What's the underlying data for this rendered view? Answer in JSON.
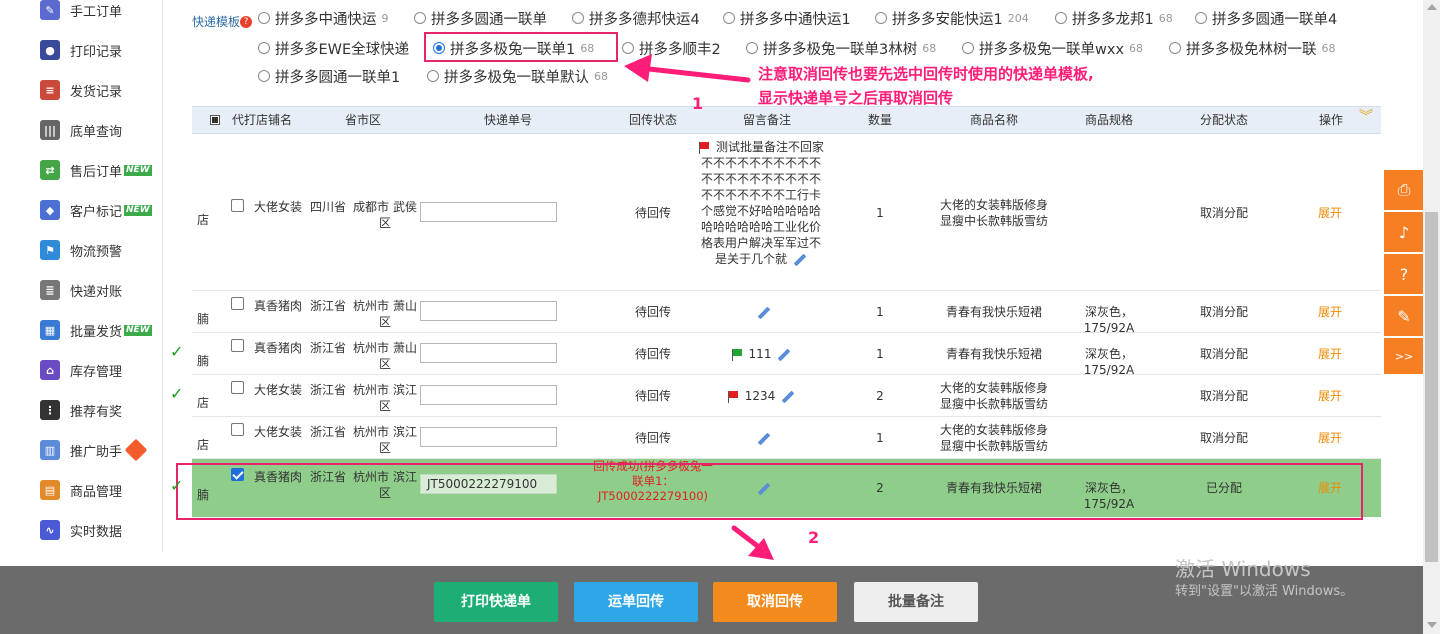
{
  "sidebar": {
    "items": [
      {
        "label": "手工订单",
        "icon": "manual-order-icon",
        "color": "#5a6acf",
        "glyph": "✎"
      },
      {
        "label": "打印记录",
        "icon": "print-record-icon",
        "color": "#3a4a9b",
        "glyph": "●"
      },
      {
        "label": "发货记录",
        "icon": "shipping-record-icon",
        "color": "#c94a3a",
        "glyph": "≡"
      },
      {
        "label": "底单查询",
        "icon": "receipt-query-icon",
        "color": "#666666",
        "glyph": "|||"
      },
      {
        "label": "售后订单",
        "icon": "after-sale-icon",
        "color": "#45a546",
        "glyph": "⇄",
        "badge": "NEW"
      },
      {
        "label": "客户标记",
        "icon": "customer-tag-icon",
        "color": "#4c6fd4",
        "glyph": "◆",
        "badge": "NEW"
      },
      {
        "label": "物流预警",
        "icon": "logistics-alert-icon",
        "color": "#2f8ad8",
        "glyph": "⚑"
      },
      {
        "label": "快递对账",
        "icon": "express-reconcile-icon",
        "color": "#777777",
        "glyph": "≣"
      },
      {
        "label": "批量发货",
        "icon": "batch-ship-icon",
        "color": "#3a79d4",
        "glyph": "▦",
        "badge": "NEW"
      },
      {
        "label": "库存管理",
        "icon": "inventory-icon",
        "color": "#6a4bc4",
        "glyph": "⌂"
      },
      {
        "label": "推荐有奖",
        "icon": "referral-icon",
        "color": "#333333",
        "glyph": "⋮"
      },
      {
        "label": "推广助手",
        "icon": "promotion-icon",
        "color": "#5a8ad8",
        "glyph": "▥",
        "gift": true
      },
      {
        "label": "商品管理",
        "icon": "product-manage-icon",
        "color": "#e28a2a",
        "glyph": "▤"
      },
      {
        "label": "实时数据",
        "icon": "realtime-data-icon",
        "color": "#4a5ad4",
        "glyph": "∿"
      }
    ]
  },
  "templates": {
    "label": "快递模板",
    "options": [
      {
        "label": "拼多多中通快运",
        "count": "9",
        "selected": false
      },
      {
        "label": "拼多多圆通一联单",
        "count": "",
        "selected": false
      },
      {
        "label": "拼多多德邦快运4",
        "count": "",
        "selected": false
      },
      {
        "label": "拼多多中通快运1",
        "count": "",
        "selected": false
      },
      {
        "label": "拼多多安能快运1",
        "count": "204",
        "selected": false
      },
      {
        "label": "拼多多龙邦1",
        "count": "68",
        "selected": false
      },
      {
        "label": "拼多多圆通一联单4",
        "count": "",
        "selected": false
      },
      {
        "label": "拼多多EWE全球快递",
        "count": "",
        "selected": false
      },
      {
        "label": "拼多多极兔一联单1",
        "count": "68",
        "selected": true
      },
      {
        "label": "拼多多顺丰2",
        "count": "",
        "selected": false
      },
      {
        "label": "拼多多极兔一联单3林树",
        "count": "68",
        "selected": false
      },
      {
        "label": "拼多多极兔一联单wxx",
        "count": "68",
        "selected": false
      },
      {
        "label": "拼多多极免林树一联",
        "count": "68",
        "selected": false
      },
      {
        "label": "拼多多圆通一联单1",
        "count": "",
        "selected": false
      },
      {
        "label": "拼多多极兔一联单默认",
        "count": "68",
        "selected": false
      }
    ]
  },
  "annotation": {
    "note_line1": "注意取消回传也要先选中回传时使用的快递单模板,",
    "note_line2": "显示快递单号之后再取消回传",
    "step1": "1",
    "step2": "2",
    "color": "#ff1d78"
  },
  "table": {
    "headers": [
      "代打店铺名",
      "省市区",
      "快递单号",
      "回传状态",
      "留言备注",
      "数量",
      "商品名称",
      "商品规格",
      "分配状态",
      "操作"
    ],
    "rows": [
      {
        "prefix": "店",
        "shop": "大佬女装",
        "prov": "四川省",
        "city": "成都市",
        "district": "武侯区",
        "tracking": "",
        "status": "待回传",
        "remark": "测试批量备注不回家不不不不不不不不不不不不不不不不不不不不不不不不不不不工行卡个感觉不好哈哈哈哈哈哈哈哈哈哈哈工业化价格表用户解决军军过不是关于几个就",
        "flag": "red",
        "qty": "1",
        "product": "大佬的女装韩版修身显瘦中长款韩版雪纺",
        "spec": "",
        "assign": "取消分配",
        "action": "展开",
        "checked": false,
        "tick": false
      },
      {
        "prefix": "腩",
        "shop": "真香猪肉",
        "prov": "浙江省",
        "city": "杭州市",
        "district": "萧山区",
        "tracking": "",
        "status": "待回传",
        "remark": "",
        "flag": "",
        "qty": "1",
        "product": "青春有我快乐短裙",
        "spec": "深灰色，175/92A",
        "assign": "取消分配",
        "action": "展开",
        "checked": false,
        "tick": false
      },
      {
        "prefix": "腩",
        "shop": "真香猪肉",
        "prov": "浙江省",
        "city": "杭州市",
        "district": "萧山区",
        "tracking": "",
        "status": "待回传",
        "remark": "111",
        "flag": "green",
        "qty": "1",
        "product": "青春有我快乐短裙",
        "spec": "深灰色，175/92A",
        "assign": "取消分配",
        "action": "展开",
        "checked": false,
        "tick": true
      },
      {
        "prefix": "店",
        "shop": "大佬女装",
        "prov": "浙江省",
        "city": "杭州市",
        "district": "滨江区",
        "tracking": "",
        "status": "待回传",
        "remark": "1234",
        "flag": "red",
        "qty": "2",
        "product": "大佬的女装韩版修身显瘦中长款韩版雪纺",
        "spec": "",
        "assign": "取消分配",
        "action": "展开",
        "checked": false,
        "tick": true
      },
      {
        "prefix": "店",
        "shop": "大佬女装",
        "prov": "浙江省",
        "city": "杭州市",
        "district": "滨江区",
        "tracking": "",
        "status": "待回传",
        "remark": "",
        "flag": "",
        "qty": "1",
        "product": "大佬的女装韩版修身显瘦中长款韩版雪纺",
        "spec": "",
        "assign": "取消分配",
        "action": "展开",
        "checked": false,
        "tick": false
      },
      {
        "prefix": "腩",
        "shop": "真香猪肉",
        "prov": "浙江省",
        "city": "杭州市",
        "district": "滨江区",
        "tracking": "JT5000222279100",
        "status": "回传成功(拼多多极兔一联单1：JT5000222279100)",
        "remark": "",
        "flag": "",
        "qty": "2",
        "product": "青春有我快乐短裙",
        "spec": "深灰色，175/92A",
        "assign": "已分配",
        "action": "展开",
        "checked": true,
        "tick": true
      }
    ]
  },
  "float_tools": [
    "printer-icon",
    "bell-icon",
    "help-icon",
    "edit-icon",
    "expand-icon"
  ],
  "float_glyphs": [
    "⎙",
    "♪",
    "?",
    "✎",
    ">>"
  ],
  "bottom": {
    "buttons": [
      {
        "label": "打印快递单",
        "color": "#1cae74"
      },
      {
        "label": "运单回传",
        "color": "#2fa7e6"
      },
      {
        "label": "取消回传",
        "color": "#f38b1c"
      },
      {
        "label": "批量备注",
        "color": "#eeeeee"
      }
    ]
  },
  "watermark": {
    "line1": "激活 Windows",
    "line2": "转到\"设置\"以激活 Windows。"
  }
}
